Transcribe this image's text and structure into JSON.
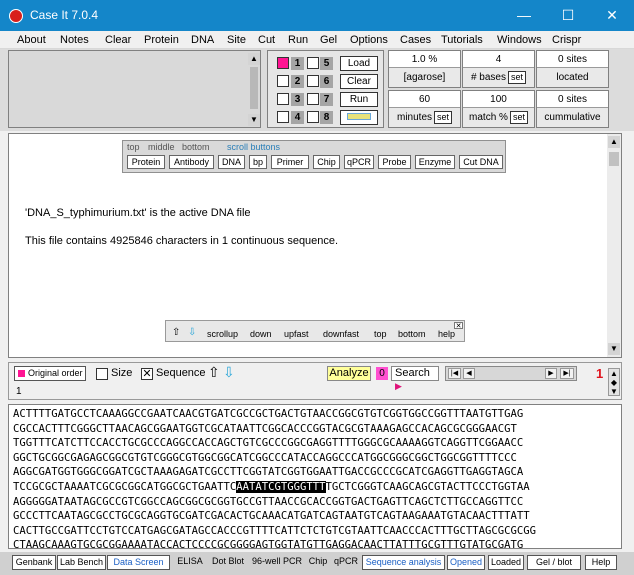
{
  "window": {
    "title": "Case It 7.0.4",
    "minimize": "—",
    "maximize": "☐",
    "close": "✕"
  },
  "menu": [
    "About",
    "Notes",
    "Clear",
    "Protein",
    "DNA",
    "Site",
    "Cut",
    "Run",
    "Gel",
    "Options",
    "Cases",
    "Tutorials",
    "Windows",
    "Crispr"
  ],
  "lanes": {
    "numbers": [
      "1",
      "2",
      "3",
      "4",
      "5",
      "6",
      "7",
      "8"
    ],
    "load": "Load",
    "clear": "Clear",
    "run": "Run"
  },
  "stats": {
    "agarose_value": "1.0 %",
    "agarose_label": "[agarose]",
    "bases_value": "4",
    "bases_label": "# bases",
    "sites_located_value": "0 sites",
    "sites_located_label": "located",
    "minutes_value": "60",
    "minutes_label": "minutes",
    "match_value": "100",
    "match_label": "match %",
    "sites_cum_value": "0 sites",
    "sites_cum_label": "cummulative",
    "set": "set"
  },
  "palette": {
    "tabs": [
      "top",
      "middle",
      "bottom",
      "scroll buttons"
    ],
    "buttons": [
      "Protein",
      "Antibody",
      "DNA",
      "bp",
      "Primer",
      "Chip",
      "qPCR",
      "Probe",
      "Enzyme",
      "Cut DNA"
    ]
  },
  "main": {
    "line1": "'DNA_S_typhimurium.txt' is the active DNA file",
    "line2": "This file contains 4925846 characters in 1 continuous sequence."
  },
  "scroll_palette": {
    "close": "✕",
    "items": [
      "scrollup",
      "down",
      "upfast",
      "downfast",
      "top",
      "bottom",
      "help"
    ]
  },
  "seqbar": {
    "original_order": "Original order",
    "size": "Size",
    "sequence": "Sequence",
    "analyze": "Analyze",
    "zero": "0",
    "search": "Search",
    "position": "1",
    "counter": "1"
  },
  "sequence": {
    "lines": [
      "ACTTTTGATGCCTCAAAGGCCGAATCAACGTGATCGCCGCTGACTGTAACCGGCGTGTCGGTGGCCGGTTTAATGTTGAG",
      "CGCCACTTTCGGGCTTAACAGCGGAATGGTCGCATAATTCGGCACCCGGTACGCGTAAAGAGCCACAGCGCGGGAACGT",
      "TGGTTTCATCTTCCACCTGCGCCCAGGCCACCAGCTGTCGCCCGGCGAGGTTTTGGGCGCAAAAGGTCAGGTTCGGAACC",
      "GGCTGCGGCGAGAGCGGCGTGTCGGGCGTGGCGGCATCGGCCCATACCAGGCCCATGGCGGGCGGCTGGCGGTTTTCCC",
      "AGGCGATGGTGGGCGGATCGCTAAAGAGATCGCCTTCGGTATCGGTGGAATTGACCGCCCGCATCGAGGTTGAGGTAGCA",
      "TCCGCGCTAAAATCGCGCGGCATGGCGCTGAATTC",
      "AGGGGGATAATAGCGCCGTCGGCCAGCGGCGCGGTGCCGTTAACCGCACCGGTGACTGAGTTCAGCTCTTGCCAGGTTCC",
      "GCCCTTCAATAGCGCCTGCGCAGGTGCGATCGACACTGCAAACATGATCAGTAATGTCAGTAAGAAATGTACAACTTTATT",
      "CACTTGCCGATTCCTGTCCATGAGCGATAGCCACCCGTTTTCATTCTCTGTCGTAATTCAACCCACTTTGCTTAGCGCGCGG",
      "CTAAGCAAAGTGCGCGGAAAATACCACTCCCCGCGGGGAGTGGTATGTTGAGGACAACTTATTTGCGTTTGTATGCGATG"
    ],
    "line6_selected": "AATATCGTGGGTTT",
    "line6_rest": "TGCTCGGGTCAAGCAGCGTACTTCCCTGGTAA"
  },
  "statusbar": [
    "Genbank",
    "Lab Bench",
    "Data Screen",
    "ELISA",
    "Dot Blot",
    "96-well PCR",
    "Chip",
    "qPCR",
    "Sequence analysis",
    "Opened",
    "Loaded",
    "Gel / blot",
    "Help"
  ]
}
